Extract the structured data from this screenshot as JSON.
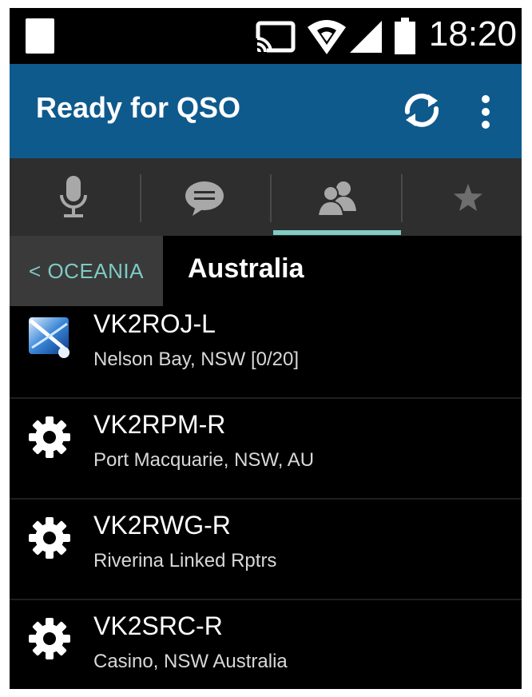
{
  "status_bar": {
    "time": "18:20",
    "icons": [
      "notification-icon",
      "cast-icon",
      "wifi-icon",
      "signal-icon",
      "battery-icon"
    ]
  },
  "app_bar": {
    "title": "Ready for QSO",
    "actions": [
      "refresh-icon",
      "overflow-menu-icon"
    ]
  },
  "tabs": [
    {
      "icon": "microphone-icon",
      "active": false
    },
    {
      "icon": "chat-icon",
      "active": false
    },
    {
      "icon": "people-icon",
      "active": true
    },
    {
      "icon": "star-icon",
      "active": false
    }
  ],
  "breadcrumb": {
    "back_label": "< OCEANIA",
    "title": "Australia"
  },
  "colors": {
    "app_bar": "#0f5a8d",
    "tab_bar": "#2e2e2e",
    "accent": "#80cbc4",
    "background": "#000000"
  },
  "nodes": [
    {
      "callsign": "VK2ROJ-L",
      "location": "Nelson Bay, NSW [0/20]",
      "icon": "echolink-icon"
    },
    {
      "callsign": "VK2RPM-R",
      "location": "Port Macquarie, NSW, AU",
      "icon": "gear-icon"
    },
    {
      "callsign": "VK2RWG-R",
      "location": "Riverina Linked Rptrs",
      "icon": "gear-icon"
    },
    {
      "callsign": "VK2SRC-R",
      "location": "Casino, NSW Australia",
      "icon": "gear-icon"
    }
  ]
}
